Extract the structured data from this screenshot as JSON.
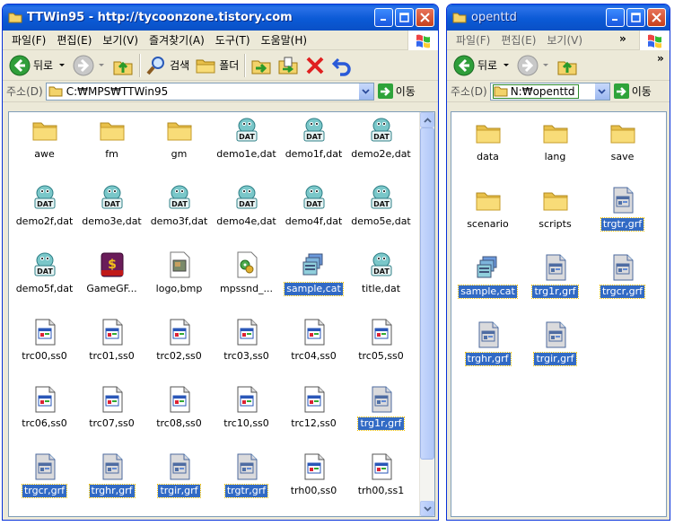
{
  "win1": {
    "title": "TTWin95 - http://tycoonzone.tistory.com",
    "menu": [
      "파일(F)",
      "편집(E)",
      "보기(V)",
      "즐겨찾기(A)",
      "도구(T)",
      "도움말(H)"
    ],
    "back_label": "뒤로",
    "search_label": "검색",
    "folders_label": "폴더",
    "address_label": "주소(D)",
    "address_value": "C:₩MPS₩TTWin95",
    "go_label": "이동",
    "items": [
      {
        "name": "awe",
        "icon": "folder-icon",
        "selected": false
      },
      {
        "name": "fm",
        "icon": "folder-icon",
        "selected": false
      },
      {
        "name": "gm",
        "icon": "folder-icon",
        "selected": false
      },
      {
        "name": "demo1e,dat",
        "icon": "dat-file-icon",
        "selected": false
      },
      {
        "name": "demo1f,dat",
        "icon": "dat-file-icon",
        "selected": false
      },
      {
        "name": "demo2e,dat",
        "icon": "dat-file-icon",
        "selected": false
      },
      {
        "name": "demo2f,dat",
        "icon": "dat-file-icon",
        "selected": false
      },
      {
        "name": "demo3e,dat",
        "icon": "dat-file-icon",
        "selected": false
      },
      {
        "name": "demo3f,dat",
        "icon": "dat-file-icon",
        "selected": false
      },
      {
        "name": "demo4e,dat",
        "icon": "dat-file-icon",
        "selected": false
      },
      {
        "name": "demo4f,dat",
        "icon": "dat-file-icon",
        "selected": false
      },
      {
        "name": "demo5e,dat",
        "icon": "dat-file-icon",
        "selected": false
      },
      {
        "name": "demo5f,dat",
        "icon": "dat-file-icon",
        "selected": false
      },
      {
        "name": "GameGF...",
        "icon": "deluxe-app-icon",
        "selected": false
      },
      {
        "name": "logo,bmp",
        "icon": "bitmap-file-icon",
        "selected": false
      },
      {
        "name": "mpssnd_...",
        "icon": "settings-file-icon",
        "selected": false
      },
      {
        "name": "sample,cat",
        "icon": "cat-file-icon",
        "selected": true
      },
      {
        "name": "title,dat",
        "icon": "dat-file-icon",
        "selected": false
      },
      {
        "name": "trc00,ss0",
        "icon": "window-file-icon",
        "selected": false
      },
      {
        "name": "trc01,ss0",
        "icon": "window-file-icon",
        "selected": false
      },
      {
        "name": "trc02,ss0",
        "icon": "window-file-icon",
        "selected": false
      },
      {
        "name": "trc03,ss0",
        "icon": "window-file-icon",
        "selected": false
      },
      {
        "name": "trc04,ss0",
        "icon": "window-file-icon",
        "selected": false
      },
      {
        "name": "trc05,ss0",
        "icon": "window-file-icon",
        "selected": false
      },
      {
        "name": "trc06,ss0",
        "icon": "window-file-icon",
        "selected": false
      },
      {
        "name": "trc07,ss0",
        "icon": "window-file-icon",
        "selected": false
      },
      {
        "name": "trc08,ss0",
        "icon": "window-file-icon",
        "selected": false
      },
      {
        "name": "trc10,ss0",
        "icon": "window-file-icon",
        "selected": false
      },
      {
        "name": "trc12,ss0",
        "icon": "window-file-icon",
        "selected": false
      },
      {
        "name": "trg1r,grf",
        "icon": "window-file-icon",
        "selected": true
      },
      {
        "name": "trgcr,grf",
        "icon": "window-file-icon",
        "selected": true
      },
      {
        "name": "trghr,grf",
        "icon": "window-file-icon",
        "selected": true
      },
      {
        "name": "trgir,grf",
        "icon": "window-file-icon",
        "selected": true
      },
      {
        "name": "trgtr,grf",
        "icon": "window-file-icon",
        "selected": true
      },
      {
        "name": "trh00,ss0",
        "icon": "window-file-icon",
        "selected": false
      },
      {
        "name": "trh00,ss1",
        "icon": "window-file-icon",
        "selected": false
      }
    ]
  },
  "win2": {
    "title": "openttd",
    "menu": [
      "파일(F)",
      "편집(E)",
      "보기(V)"
    ],
    "back_label": "뒤로",
    "address_label": "주소(D)",
    "address_value": "N:₩openttd",
    "go_label": "이동",
    "items": [
      {
        "name": "data",
        "icon": "folder-icon",
        "selected": false
      },
      {
        "name": "lang",
        "icon": "folder-icon",
        "selected": false
      },
      {
        "name": "save",
        "icon": "folder-icon",
        "selected": false
      },
      {
        "name": "scenario",
        "icon": "folder-icon",
        "selected": false
      },
      {
        "name": "scripts",
        "icon": "folder-icon",
        "selected": false
      },
      {
        "name": "trgtr,grf",
        "icon": "window-file-icon",
        "selected": true
      },
      {
        "name": "sample,cat",
        "icon": "cat-file-icon",
        "selected": true
      },
      {
        "name": "trg1r,grf",
        "icon": "window-file-icon",
        "selected": true
      },
      {
        "name": "trgcr,grf",
        "icon": "window-file-icon",
        "selected": true
      },
      {
        "name": "trghr,grf",
        "icon": "window-file-icon",
        "selected": true
      },
      {
        "name": "trgir,grf",
        "icon": "window-file-icon",
        "selected": true
      }
    ]
  },
  "colors": {
    "title_blue": "#0b5ad6",
    "selection": "#316ac5",
    "window_face": "#ece9d8"
  }
}
